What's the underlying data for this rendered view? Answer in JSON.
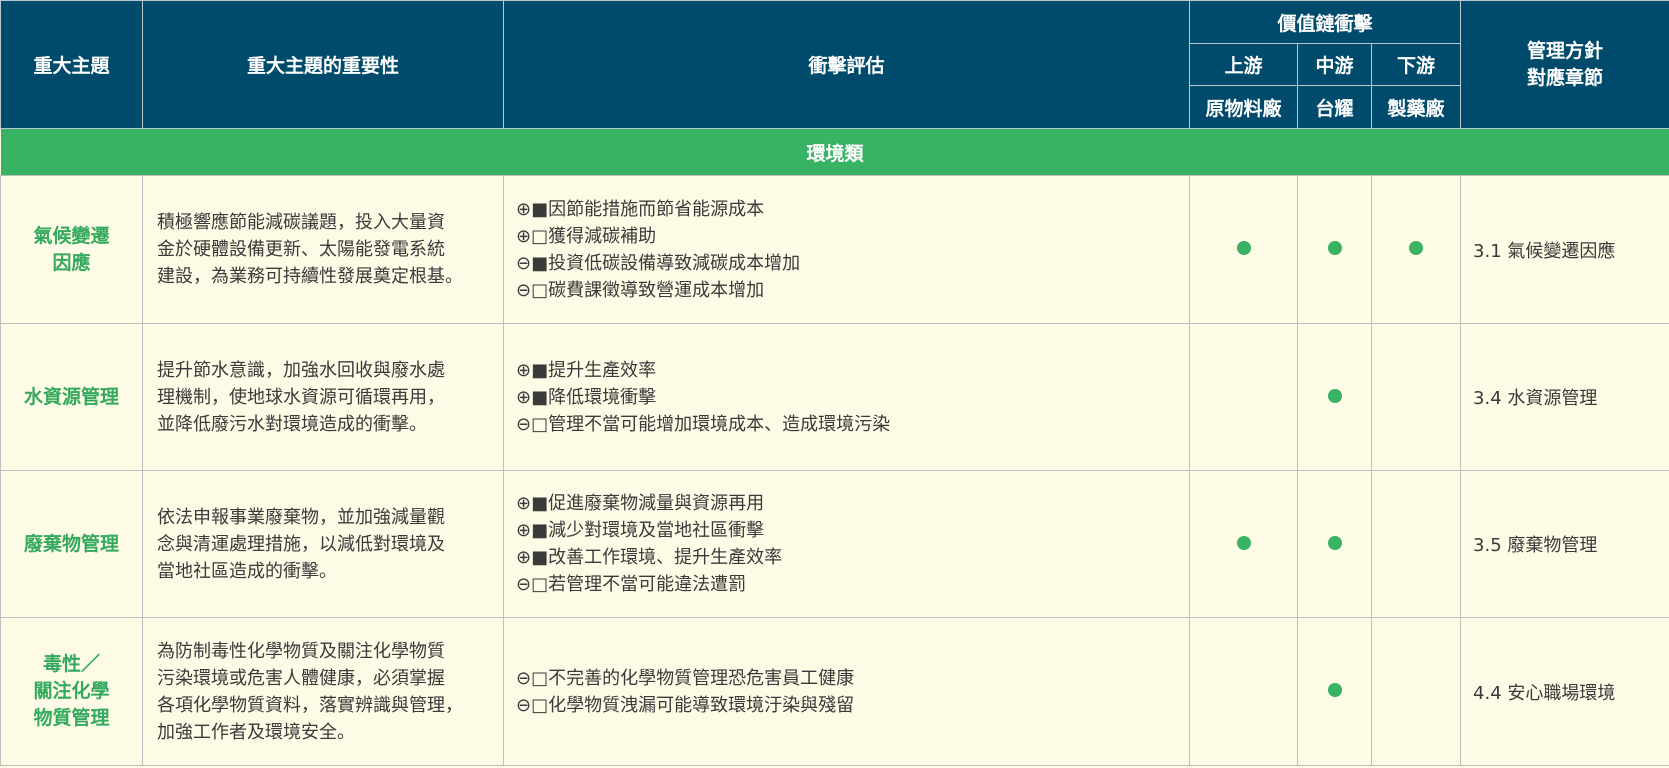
{
  "header": {
    "topic": "重大主題",
    "importance": "重大主題的重要性",
    "impact": "衝擊評估",
    "value_chain": "價值鏈衝擊",
    "upstream": "上游",
    "midstream": "中游",
    "downstream": "下游",
    "upstream_sub": "原物料廠",
    "midstream_sub": "台耀",
    "downstream_sub": "製藥廠",
    "policy_line1": "管理方針",
    "policy_line2": "對應章節"
  },
  "category": "環境類",
  "colors": {
    "header_bg": "#004b6b",
    "category_bg": "#38b263",
    "topic_text": "#35a95e",
    "dot": "#38b263",
    "body_bg": "#fdfbe5"
  },
  "rows": [
    {
      "topic_lines": [
        "氣候變遷",
        "因應"
      ],
      "importance_lines": [
        "積極響應節能減碳議題，投入大量資",
        "金於硬體設備更新、太陽能發電系統",
        "建設，為業務可持續性發展奠定根基。"
      ],
      "impact_lines": [
        "⊕■因節能措施而節省能源成本",
        "⊕□獲得減碳補助",
        "⊖■投資低碳設備導致減碳成本增加",
        "⊖□碳費課徵導致營運成本增加"
      ],
      "upstream": true,
      "midstream": true,
      "downstream": true,
      "chapter": "3.1 氣候變遷因應"
    },
    {
      "topic_lines": [
        "水資源管理"
      ],
      "importance_lines": [
        "提升節水意識，加強水回收與廢水處",
        "理機制，使地球水資源可循環再用，",
        "並降低廢污水對環境造成的衝擊。"
      ],
      "impact_lines": [
        "⊕■提升生產效率",
        "⊕■降低環境衝擊",
        "⊖□管理不當可能增加環境成本、造成環境污染"
      ],
      "upstream": false,
      "midstream": true,
      "downstream": false,
      "chapter": "3.4 水資源管理"
    },
    {
      "topic_lines": [
        "廢棄物管理"
      ],
      "importance_lines": [
        "依法申報事業廢棄物，並加強減量觀",
        "念與清運處理措施，以減低對環境及",
        "當地社區造成的衝擊。"
      ],
      "impact_lines": [
        "⊕■促進廢棄物減量與資源再用",
        "⊕■減少對環境及當地社區衝擊",
        "⊕■改善工作環境、提升生產效率",
        "⊖□若管理不當可能違法遭罰"
      ],
      "upstream": true,
      "midstream": true,
      "downstream": false,
      "chapter": "3.5 廢棄物管理"
    },
    {
      "topic_lines": [
        "毒性／",
        "關注化學",
        "物質管理"
      ],
      "importance_lines": [
        "為防制毒性化學物質及關注化學物質",
        "污染環境或危害人體健康，必須掌握",
        "各項化學物質資料，落實辨識與管理，",
        "加強工作者及環境安全。"
      ],
      "impact_lines": [
        "⊖□不完善的化學物質管理恐危害員工健康",
        "⊖□化學物質洩漏可能導致環境汙染與殘留"
      ],
      "upstream": false,
      "midstream": true,
      "downstream": false,
      "chapter": "4.4 安心職場環境"
    }
  ]
}
